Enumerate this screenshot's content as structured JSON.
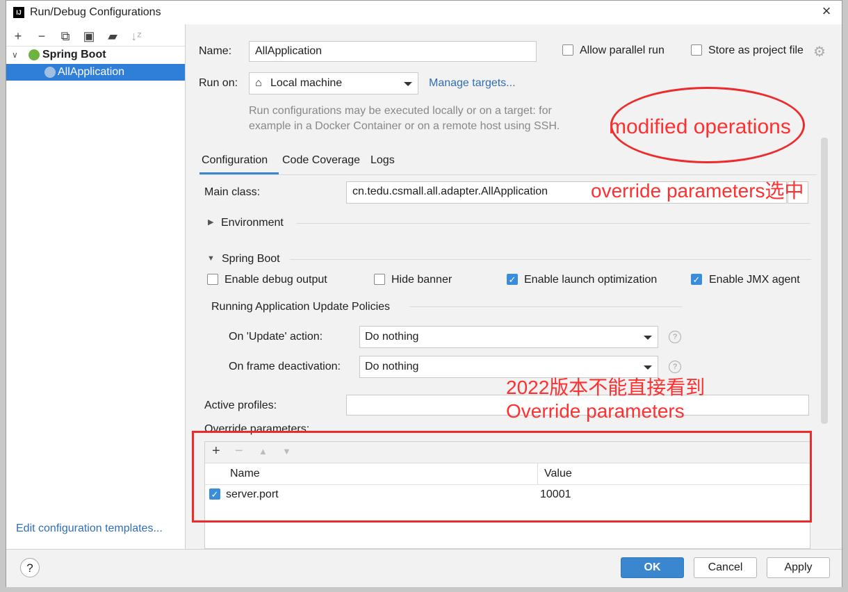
{
  "window": {
    "title": "Run/Debug Configurations",
    "close": "×",
    "logo": "IJ"
  },
  "toolbar": {
    "add": "+",
    "remove": "−",
    "copy": "⧉",
    "save": "▣",
    "folder": "▰",
    "sort": "↓ᶻ"
  },
  "tree": {
    "group": "Spring Boot",
    "item": "AllApplication"
  },
  "left_footer": {
    "templates_link": "Edit configuration templates..."
  },
  "form": {
    "name_label": "Name:",
    "name_value": "AllApplication",
    "allow_parallel": "Allow parallel run",
    "store_project": "Store as project file",
    "run_on_label": "Run on:",
    "run_on_value": "Local machine",
    "manage_targets": "Manage targets...",
    "run_on_hint_1": "Run configurations may be executed locally or on a target: for",
    "run_on_hint_2": "example in a Docker Container or on a remote host using SSH."
  },
  "tabs": [
    "Configuration",
    "Code Coverage",
    "Logs"
  ],
  "config": {
    "main_class_label": "Main class:",
    "main_class_value": "cn.tedu.csmall.all.adapter.AllApplication",
    "environment": "Environment",
    "spring_boot": "Spring Boot",
    "opt_debug": "Enable debug output",
    "opt_banner": "Hide banner",
    "opt_launch": "Enable launch optimization",
    "opt_jmx": "Enable JMX agent",
    "policies": "Running Application Update Policies",
    "on_update_label": "On 'Update' action:",
    "on_update_value": "Do nothing",
    "on_frame_label": "On frame deactivation:",
    "on_frame_value": "Do nothing",
    "active_profiles_label": "Active profiles:",
    "override_label": "Override parameters:",
    "table_toolbar": {
      "add": "+",
      "remove": "−",
      "up": "▲",
      "down": "▼"
    },
    "table_headers": [
      "Name",
      "Value"
    ],
    "table_rows": [
      {
        "name": "server.port",
        "value": "10001",
        "checked": true
      }
    ]
  },
  "buttons": {
    "help": "?",
    "ok": "OK",
    "cancel": "Cancel",
    "apply": "Apply"
  },
  "annotations": {
    "modified": "modified operations",
    "override_select": "override parameters选中",
    "note_line1": "2022版本不能直接看到",
    "note_line2": "Override parameters",
    "accent": "#ff3030"
  }
}
